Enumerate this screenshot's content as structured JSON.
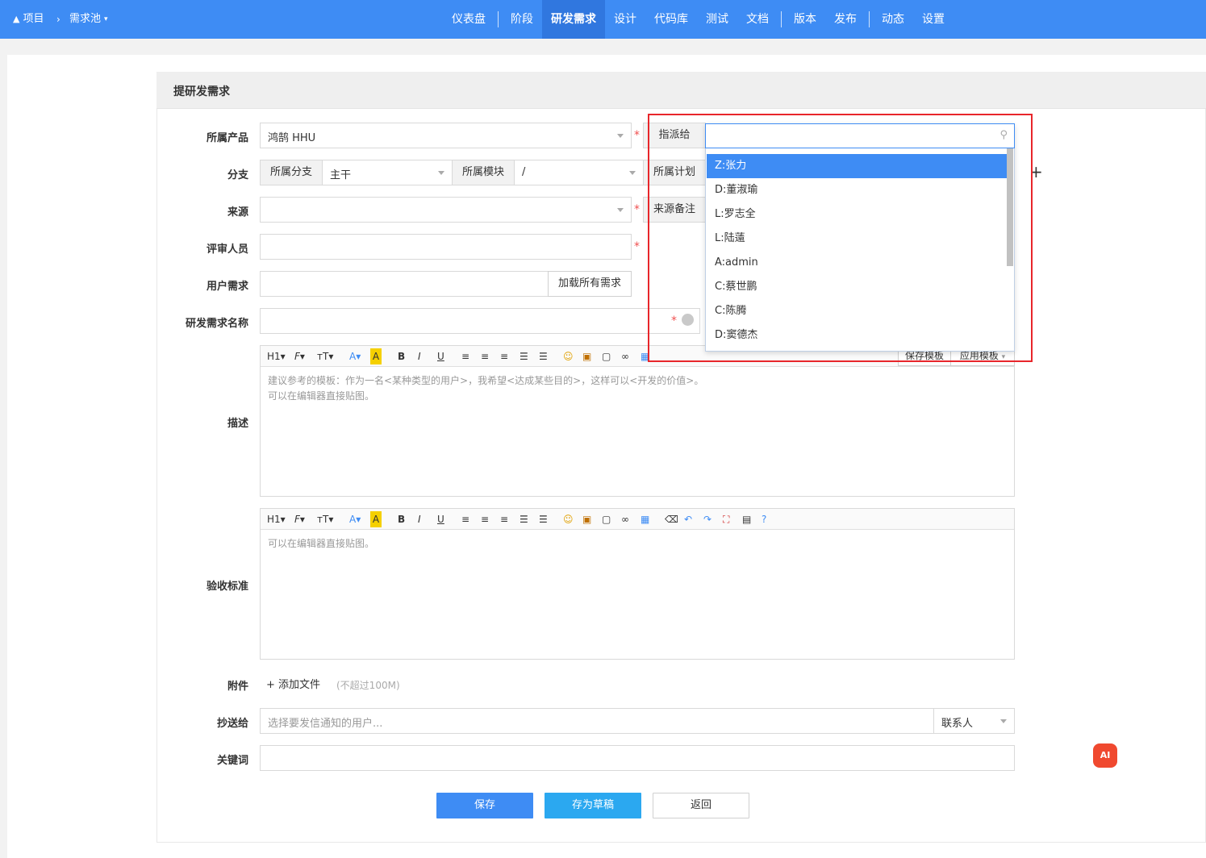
{
  "breadcrumb": {
    "project": "项目",
    "pool": "需求池"
  },
  "nav": [
    "仪表盘",
    "阶段",
    "研发需求",
    "设计",
    "代码库",
    "测试",
    "文档",
    "版本",
    "发布",
    "动态",
    "设置"
  ],
  "nav_active": "研发需求",
  "form": {
    "title": "提研发需求",
    "product_label": "所属产品",
    "product_value": "鸿鹄 HHU",
    "assign_label": "指派给",
    "branch_label": "分支",
    "branch_addon": "所属分支",
    "branch_value": "主干",
    "module_addon": "所属模块",
    "module_value": "/",
    "plan_addon": "所属计划",
    "source_label": "来源",
    "source_note_addon": "来源备注",
    "reviewer_label": "评审人员",
    "user_req_label": "用户需求",
    "load_all_btn": "加载所有需求",
    "name_label": "研发需求名称",
    "desc_label": "描述",
    "desc_placeholder": "建议参考的模板：作为一名<某种类型的用户>，我希望<达成某些目的>，这样可以<开发的价值>。\n可以在编辑器直接贴图。",
    "save_template": "保存模板",
    "apply_template": "应用模板",
    "accept_label": "验收标准",
    "accept_placeholder": "可以在编辑器直接贴图。",
    "attach_label": "附件",
    "add_file": "添加文件",
    "file_limit": "(不超过100M)",
    "cc_label": "抄送给",
    "cc_placeholder": "选择要发信通知的用户...",
    "contact": "联系人",
    "keyword_label": "关键词"
  },
  "dropdown": {
    "options": [
      "Z:张力",
      "D:董淑瑜",
      "L:罗志全",
      "L:陆薳",
      "A:admin",
      "C:蔡世鹏",
      "C:陈腾",
      "D:窦德杰"
    ],
    "selected": "Z:张力"
  },
  "buttons": {
    "save": "保存",
    "draft": "存为草稿",
    "back": "返回"
  },
  "colors": {
    "primary": "#3e8cf4",
    "draft": "#2ba8f0",
    "highlight": "#e8262b",
    "required": "#f05050"
  }
}
